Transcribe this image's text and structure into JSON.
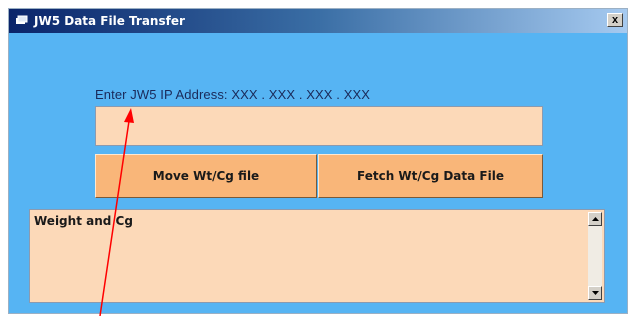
{
  "window": {
    "title": "JW5 Data File Transfer",
    "close_symbol": "x"
  },
  "ip": {
    "label": "Enter JW5 IP Address:  XXX . XXX . XXX . XXX",
    "value": "",
    "placeholder": ""
  },
  "buttons": {
    "move_label": "Move Wt/Cg file",
    "fetch_label": "Fetch Wt/Cg  Data File"
  },
  "output": {
    "text": "Weight and Cg"
  },
  "icons": {
    "title_icon": "app-icon",
    "close_icon": "close-icon",
    "scroll_up": "scroll-up-arrow-icon",
    "scroll_down": "scroll-down-arrow-icon",
    "annotation": "red-arrow-annotation"
  },
  "colors": {
    "window_bg": "#56b4f3",
    "field_bg": "#fcd9b8",
    "button_bg": "#f9b679",
    "annotation_arrow": "#ff0000"
  }
}
